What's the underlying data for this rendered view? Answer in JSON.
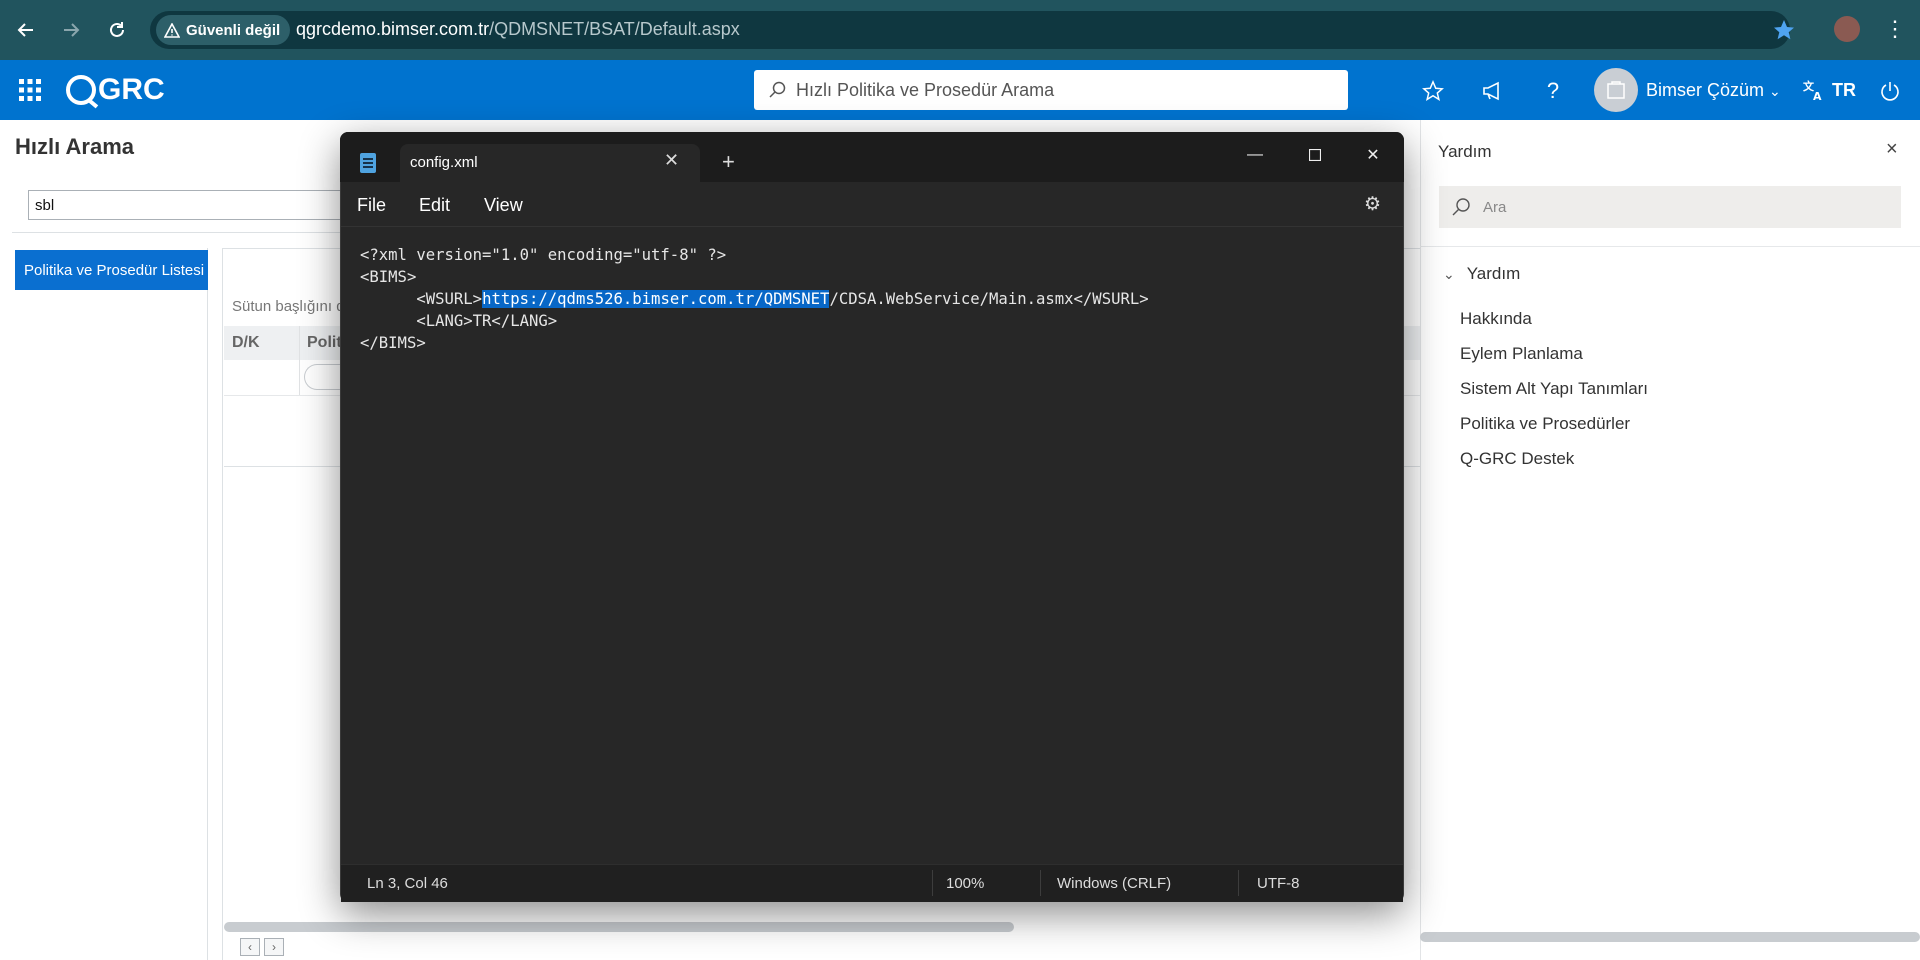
{
  "browser": {
    "security_label": "Güvenli değil",
    "url_host": "qgrcdemo.bimser.com.tr",
    "url_path": "/QDMSNET/BSAT/Default.aspx"
  },
  "app_header": {
    "logo_text": "GRC",
    "search_placeholder": "Hızlı Politika ve Prosedür Arama",
    "user_name": "Bimser Çözüm",
    "language": "TR"
  },
  "page": {
    "title": "Hızlı Arama",
    "search_value": "sbl",
    "list_tab_label": "Politika ve Prosedür Listesi",
    "grid_hint": "Sütun başlığını d",
    "columns": [
      "D/K",
      "Polit"
    ]
  },
  "help_panel": {
    "title": "Yardım",
    "close_label": "×",
    "search_placeholder": "Ara",
    "group_label": "Yardım",
    "items": [
      "Hakkında",
      "Eylem Planlama",
      "Sistem Alt Yapı Tanımları",
      "Politika ve Prosedürler",
      "Q-GRC Destek"
    ]
  },
  "notepad": {
    "tab_title": "config.xml",
    "menu": [
      "File",
      "Edit",
      "View"
    ],
    "code": {
      "line1": "<?xml version=\"1.0\" encoding=\"utf-8\" ?>",
      "line2": "<BIMS>",
      "line3_prefix": "      <WSURL>",
      "line3_selected": "https://qdms526.bimser.com.tr/QDMSNET",
      "line3_suffix": "/CDSA.WebService/Main.asmx</WSURL>",
      "line4": "      <LANG>TR</LANG>",
      "line5": "</BIMS>"
    },
    "status": {
      "position": "Ln 3, Col 46",
      "zoom": "100%",
      "line_ending": "Windows (CRLF)",
      "encoding": "UTF-8"
    }
  },
  "colors": {
    "browser_bar": "#21545e",
    "app_header": "#0073cf",
    "selection": "#0867c7",
    "notepad_bg": "#272727"
  }
}
